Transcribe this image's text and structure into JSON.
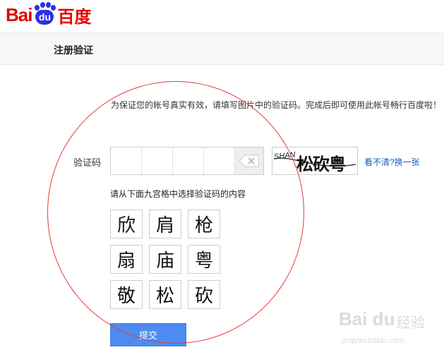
{
  "logo": {
    "bai": "Bai",
    "du": "du",
    "cn": "百度"
  },
  "page_title": "注册验证",
  "notice": "为保证您的帐号真实有效，请填写图片中的验证码。完成后即可使用此帐号畅行百度啦！",
  "captcha": {
    "label": "验证码",
    "image_prefix": "SHAN",
    "image_chars": "松砍粤",
    "refresh_link": "看不清?换一张"
  },
  "grid_prompt": "请从下面九宫格中选择验证码的内容",
  "grid": [
    "欣",
    "肩",
    "枪",
    "扇",
    "庙",
    "粤",
    "敬",
    "松",
    "砍"
  ],
  "submit_label": "提交",
  "watermark": {
    "logo": "Bai du",
    "cn": "经验",
    "url": "jingyan.baidu.com"
  },
  "colors": {
    "brand_red": "#e10601",
    "brand_blue": "#2932e1",
    "button_blue": "#4c8cf0",
    "annotation_circle": "#e33b3b"
  }
}
